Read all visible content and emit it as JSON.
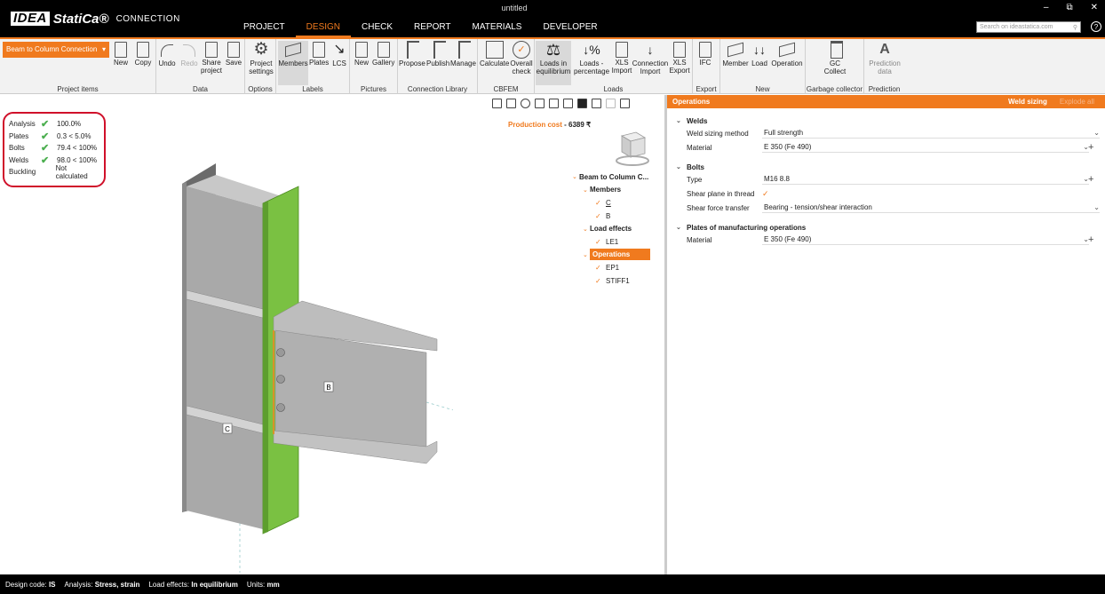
{
  "app": {
    "logo_brand": "IDEA StatiCa",
    "logo_product": "CONNECTION",
    "window_title": "untitled",
    "search_placeholder": "Search on ideastatica.com",
    "help": "?"
  },
  "main_menu": [
    "PROJECT",
    "DESIGN",
    "CHECK",
    "REPORT",
    "MATERIALS",
    "DEVELOPER"
  ],
  "ribbon": {
    "connection_select": "Beam to Column Connection",
    "groups": {
      "project_items": {
        "label": "Project items",
        "new": "New",
        "copy": "Copy"
      },
      "data": {
        "label": "Data",
        "undo": "Undo",
        "redo": "Redo",
        "share": "Share project",
        "save": "Save"
      },
      "options": {
        "label": "Options",
        "project_settings": "Project settings"
      },
      "labels": {
        "label": "Labels",
        "members": "Members",
        "plates": "Plates",
        "lcs": "LCS"
      },
      "pictures": {
        "label": "Pictures",
        "new": "New",
        "gallery": "Gallery"
      },
      "conn_library": {
        "label": "Connection Library",
        "propose": "Propose",
        "publish": "Publish",
        "manage": "Manage"
      },
      "cbfem": {
        "label": "CBFEM",
        "calculate": "Calculate",
        "overall": "Overall check"
      },
      "loads": {
        "label": "Loads",
        "equilibrium": "Loads in equilibrium",
        "percentage": "Loads - percentage",
        "xls_import": "XLS Import",
        "conn_import": "Connection Import",
        "xls_export": "XLS Export"
      },
      "export": {
        "label": "Export",
        "ifc": "IFC"
      },
      "new": {
        "label": "New",
        "member": "Member",
        "load": "Load",
        "operation": "Operation"
      },
      "garbage": {
        "label": "Garbage collector",
        "gc": "GC Collect"
      },
      "prediction": {
        "label": "Prediction",
        "data": "Prediction data"
      }
    }
  },
  "checks": [
    {
      "name": "Analysis",
      "value": "100.0%",
      "ok": true
    },
    {
      "name": "Plates",
      "value": "0.3 < 5.0%",
      "ok": true
    },
    {
      "name": "Bolts",
      "value": "79.4 < 100%",
      "ok": true
    },
    {
      "name": "Welds",
      "value": "98.0 < 100%",
      "ok": true
    },
    {
      "name": "Buckling",
      "value": "Not calculated",
      "ok": false
    }
  ],
  "production_cost": {
    "label": "Production cost",
    "value": "6389 ₹"
  },
  "model_labels": {
    "beam": "B",
    "column": "C"
  },
  "tree": {
    "root": "Beam to Column C...",
    "members_label": "Members",
    "members": [
      "C",
      "B"
    ],
    "load_effects_label": "Load effects",
    "load_effects": [
      "LE1"
    ],
    "operations_label": "Operations",
    "operations": [
      "EP1",
      "STIFF1"
    ]
  },
  "panel": {
    "title": "Operations",
    "weld_sizing": "Weld sizing",
    "explode_all": "Explode all",
    "welds": {
      "title": "Welds",
      "sizing_label": "Weld sizing method",
      "sizing_value": "Full strength",
      "material_label": "Material",
      "material_value": "E 350 (Fe 490)"
    },
    "bolts": {
      "title": "Bolts",
      "type_label": "Type",
      "type_value": "M16 8.8",
      "shear_plane_label": "Shear plane in thread",
      "shear_transfer_label": "Shear force transfer",
      "shear_transfer_value": "Bearing - tension/shear interaction"
    },
    "plates": {
      "title": "Plates of manufacturing operations",
      "material_label": "Material",
      "material_value": "E 350 (Fe 490)"
    }
  },
  "status": {
    "design_code_label": "Design code:",
    "design_code": "IS",
    "analysis_label": "Analysis:",
    "analysis": "Stress, strain",
    "load_effects_label": "Load effects:",
    "load_effects": "In equilibrium",
    "units_label": "Units:",
    "units": "mm"
  },
  "colors": {
    "accent": "#f07a1e",
    "endplate": "#7ac142",
    "check_ok": "#4caf50",
    "highlight": "#d0102a"
  }
}
